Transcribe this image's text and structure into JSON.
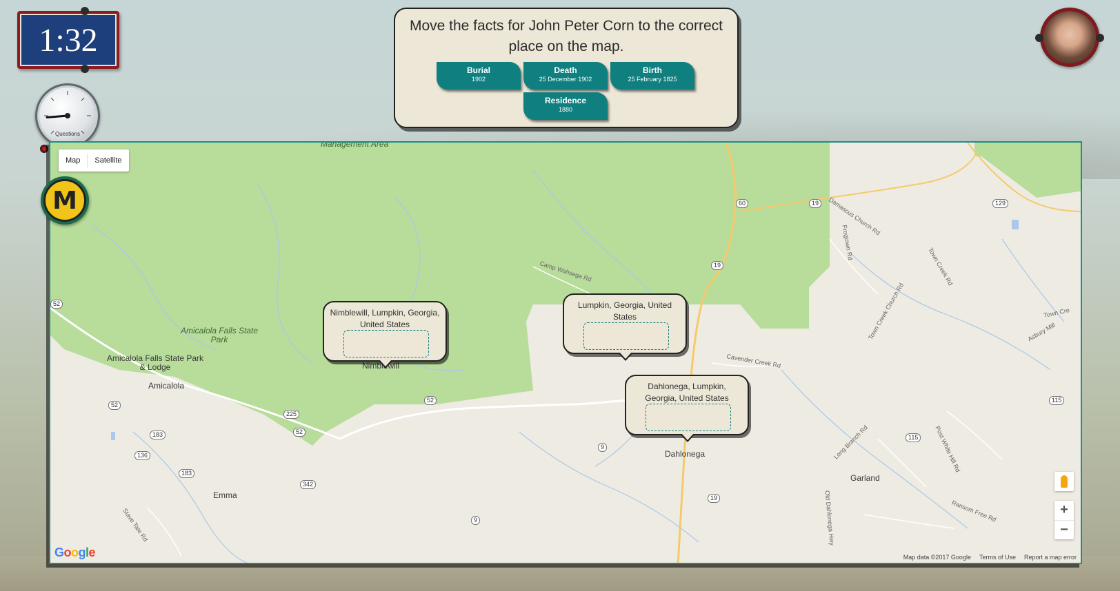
{
  "timer": {
    "value": "1:32"
  },
  "gauge": {
    "label": "Questions",
    "level": 0.15
  },
  "avatar": {
    "icon": "player-avatar"
  },
  "panel": {
    "instructions": "Move the facts for John Peter Corn to the correct place on the map.",
    "facts": [
      {
        "title": "Burial",
        "sub": "1902"
      },
      {
        "title": "Death",
        "sub": "25 December 1902"
      },
      {
        "title": "Birth",
        "sub": "25 February 1825"
      },
      {
        "title": "Residence",
        "sub": "1880"
      }
    ]
  },
  "map": {
    "type_map": "Map",
    "type_satellite": "Satellite",
    "badge": "M",
    "zoom_in": "+",
    "zoom_out": "−",
    "logo": "Google",
    "footer": {
      "data": "Map data ©2017 Google",
      "terms": "Terms of Use",
      "report": "Report a map error"
    },
    "places": {
      "management": "Management Area",
      "amicalola_park": "Amicalola Falls State Park",
      "amicalola_lodge": "Amicalola Falls State Park & Lodge",
      "amicalola": "Amicalola",
      "nimblewill": "Nimblewill",
      "dahlonega": "Dahlonega",
      "emma": "Emma",
      "garland": "Garland"
    },
    "roads": {
      "camp_wahsega": "Camp Wahsega Rd",
      "cavender": "Cavender Creek Rd",
      "damascus": "Damascus Church Rd",
      "frogtown": "Frogtown Rd",
      "town_creek": "Town Creek Church Rd",
      "long_branch": "Long Branch Rd",
      "post_white": "Post White Hill Rd",
      "ransom": "Ransom Free Rd",
      "stave_tate": "Stave Tate Rd",
      "dahlonega_hwy": "Old Dahlonega Hwy",
      "town_creek_rd": "Town Creek Rd",
      "ashbury": "Asbury Mill",
      "town_cre": "Town Cre"
    },
    "shields": [
      "52",
      "52",
      "52",
      "52",
      "225",
      "183",
      "136",
      "183",
      "342",
      "9",
      "9",
      "60",
      "19",
      "19",
      "19",
      "129",
      "115",
      "115"
    ],
    "drop_targets": [
      "Nimblewill, Lumpkin, Georgia, United States",
      "Lumpkin, Georgia, United States",
      "Dahlonega, Lumpkin, Georgia, United States"
    ]
  },
  "colors": {
    "accent": "#0f7f80",
    "panel": "#ece7d6",
    "timer": "#1d3f7c",
    "frame": "#8b1c22",
    "forest": "#b8dc9a"
  }
}
